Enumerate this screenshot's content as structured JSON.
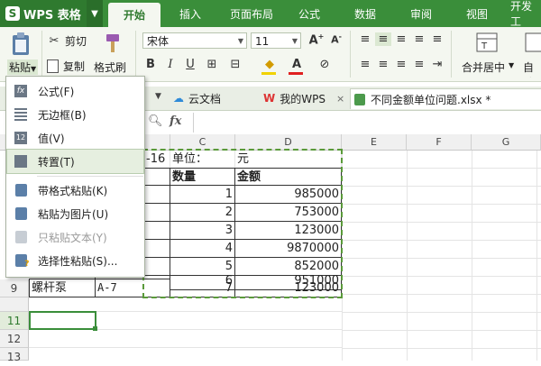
{
  "app": {
    "logo": "WPS 表格"
  },
  "ribbon_tabs": [
    "开始",
    "插入",
    "页面布局",
    "公式",
    "数据",
    "审阅",
    "视图",
    "开发工"
  ],
  "ribbon": {
    "paste": "粘贴",
    "cut": "剪切",
    "copy": "复制",
    "format_painter": "格式刷",
    "font_name": "宋体",
    "font_size": "11",
    "bold": "B",
    "italic": "I",
    "underline": "U",
    "merge_center": "合并居中",
    "auto_wrap": "自动"
  },
  "doc_tabs": [
    {
      "label": "云文档"
    },
    {
      "label": "我的WPS"
    },
    {
      "label": "不同金额单位问题.xlsx *"
    }
  ],
  "formula_bar": {
    "fx": "fx"
  },
  "columns": [
    "C",
    "D",
    "E",
    "F",
    "G"
  ],
  "rows": [
    "9",
    "11",
    "12",
    "13"
  ],
  "sheet": {
    "row2": {
      "a_partial": "-16",
      "c": "单位：",
      "d": "元"
    },
    "row3": {
      "c": "数量",
      "d": "金额"
    },
    "data": [
      {
        "qty": "1",
        "amount": "985000"
      },
      {
        "qty": "2",
        "amount": "753000"
      },
      {
        "qty": "3",
        "amount": "123000"
      },
      {
        "qty": "4",
        "amount": "9870000"
      },
      {
        "qty": "5",
        "amount": "852000"
      },
      {
        "qty": "6",
        "amount": "951000"
      },
      {
        "name": "螺杆泵",
        "code": "A-7",
        "qty": "7",
        "amount": "123000"
      }
    ]
  },
  "paste_menu": {
    "items": [
      {
        "label": "公式(F)",
        "icon": "formula-icon"
      },
      {
        "label": "无边框(B)",
        "icon": "no-border-icon"
      },
      {
        "label": "值(V)",
        "icon": "value-icon",
        "badge": "12"
      },
      {
        "label": "转置(T)",
        "icon": "transpose-icon",
        "highlighted": true
      },
      {
        "label": "带格式粘贴(K)",
        "icon": "paste-format-icon"
      },
      {
        "label": "粘贴为图片(U)",
        "icon": "paste-picture-icon"
      },
      {
        "label": "只粘贴文本(Y)",
        "icon": "paste-text-icon",
        "disabled": true
      },
      {
        "label": "选择性粘贴(S)...",
        "icon": "paste-special-icon"
      }
    ]
  },
  "colors": {
    "accent": "#3a8e3a",
    "copy_border": "#5a9a3a"
  }
}
